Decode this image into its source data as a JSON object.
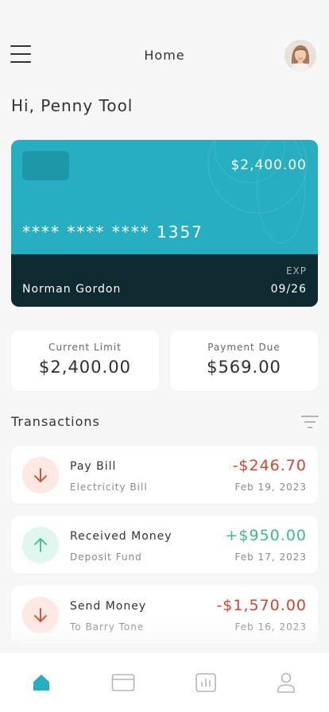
{
  "header": {
    "title": "Home",
    "menu_icon": "hamburger-menu-icon",
    "avatar_icon": "user-avatar"
  },
  "greeting": "Hi, Penny Tool",
  "card": {
    "balance": "$2,400.00",
    "number": "**** **** **** 1357",
    "holder": "Norman Gordon",
    "exp_label": "EXP",
    "exp": "09/26",
    "colors": {
      "top": "#27aec1",
      "bottom": "#0e2a30",
      "chip": "#1e97a8"
    }
  },
  "stats": {
    "current_limit": {
      "label": "Current Limit",
      "value": "$2,400.00"
    },
    "payment_due": {
      "label": "Payment Due",
      "value": "$569.00"
    }
  },
  "transactions": {
    "heading": "Transactions",
    "filter_icon": "filter-icon",
    "items": [
      {
        "title": "Pay Bill",
        "subtitle": "Electricity Bill",
        "amount": "-$246.70",
        "date": "Feb 19, 2023",
        "direction": "down",
        "icon": "arrow-down-icon"
      },
      {
        "title": "Received Money",
        "subtitle": "Deposit Fund",
        "amount": "+$950.00",
        "date": "Feb 17, 2023",
        "direction": "up",
        "icon": "arrow-up-icon"
      },
      {
        "title": "Send Money",
        "subtitle": "To Barry Tone",
        "amount": "-$1,570.00",
        "date": "Feb 16, 2023",
        "direction": "down",
        "icon": "arrow-down-icon"
      }
    ]
  },
  "bottom_nav": {
    "items": [
      {
        "icon": "home-icon",
        "active": true
      },
      {
        "icon": "card-icon",
        "active": false
      },
      {
        "icon": "chart-icon",
        "active": false
      },
      {
        "icon": "profile-icon",
        "active": false
      }
    ],
    "active_color": "#27aec1",
    "inactive_color": "#b5b5b5"
  },
  "colors": {
    "negative": "#d3452c",
    "positive": "#3cba8b",
    "accent": "#27aec1"
  }
}
